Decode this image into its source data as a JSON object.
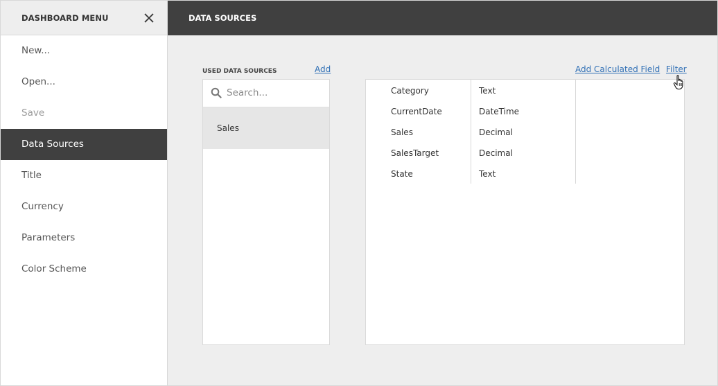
{
  "sidebar": {
    "title": "DASHBOARD MENU",
    "close_icon": "close-icon",
    "items": [
      {
        "label": "New...",
        "state": "normal"
      },
      {
        "label": "Open...",
        "state": "normal"
      },
      {
        "label": "Save",
        "state": "disabled"
      },
      {
        "label": "Data Sources",
        "state": "active"
      },
      {
        "label": "Title",
        "state": "normal"
      },
      {
        "label": "Currency",
        "state": "normal"
      },
      {
        "label": "Parameters",
        "state": "normal"
      },
      {
        "label": "Color Scheme",
        "state": "normal"
      }
    ]
  },
  "main": {
    "title": "DATA SOURCES",
    "used_data_sources": {
      "label": "USED DATA SOURCES",
      "add_link": "Add",
      "search_placeholder": "Search...",
      "items": [
        "Sales"
      ]
    },
    "fields": {
      "add_calculated_field_link": "Add Calculated Field",
      "filter_link": "Filter",
      "rows": [
        {
          "name": "Category",
          "type": "Text"
        },
        {
          "name": "CurrentDate",
          "type": "DateTime"
        },
        {
          "name": "Sales",
          "type": "Decimal"
        },
        {
          "name": "SalesTarget",
          "type": "Decimal"
        },
        {
          "name": "State",
          "type": "Text"
        }
      ]
    }
  },
  "colors": {
    "header_dark": "#404040",
    "link": "#2f6fb5",
    "panel_bg": "#eeeeee",
    "selected_item_bg": "#e6e6e6"
  }
}
